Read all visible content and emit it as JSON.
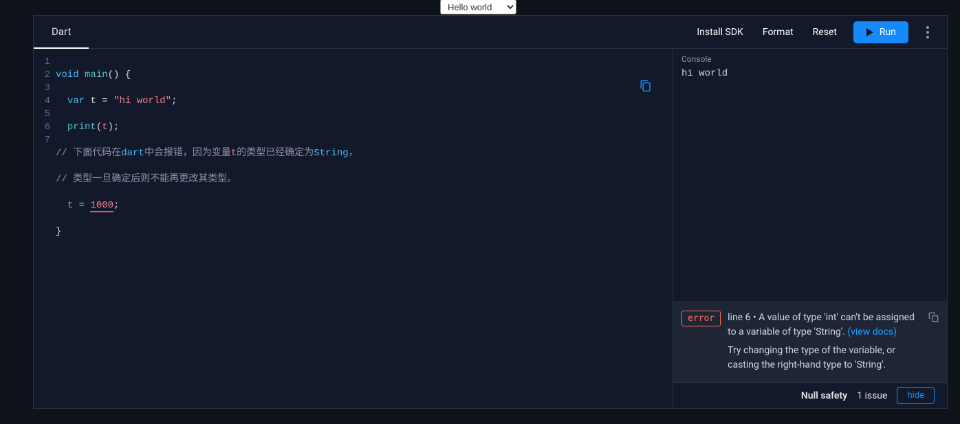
{
  "top_select": {
    "value": "Hello world"
  },
  "header": {
    "tab": "Dart",
    "install_sdk": "Install SDK",
    "format": "Format",
    "reset": "Reset",
    "run": "Run"
  },
  "code": {
    "lines": [
      "1",
      "2",
      "3",
      "4",
      "5",
      "6",
      "7"
    ],
    "l1": {
      "kw_void": "void",
      "fn_main": "main",
      "paren": "()",
      "brace": " {"
    },
    "l2": {
      "kw_var": "var",
      "sp": " ",
      "id": "t",
      "eq": " = ",
      "str": "\"hi world\"",
      "semi": ";"
    },
    "l3": {
      "fn_print": "print",
      "lp": "(",
      "id": "t",
      "rp": ")",
      "semi": ";"
    },
    "l4": {
      "cmt_pre": "// 下面代码在",
      "cmt_dart": "dart",
      "cmt_mid": "中会报错，因为变量",
      "cmt_t": "t",
      "cmt_mid2": "的类型已经确定为",
      "cmt_str": "String",
      "cmt_end": "，"
    },
    "l5": {
      "cmt": "// 类型一旦确定后则不能再更改其类型。"
    },
    "l6": {
      "id": "t",
      "eq": " = ",
      "num": "1000",
      "semi": ";"
    },
    "l7": {
      "brace": "}"
    }
  },
  "console": {
    "title": "Console",
    "output": "hi world"
  },
  "error": {
    "badge": "error",
    "msg1": "line 6 • A value of type 'int' can't be assigned to a variable of type 'String'.  ",
    "view_docs": "(view docs)",
    "msg2": "Try changing the type of the variable, or casting the right-hand type to 'String'."
  },
  "status": {
    "null_safety": "Null safety",
    "issues": "1 issue",
    "hide": "hide"
  }
}
